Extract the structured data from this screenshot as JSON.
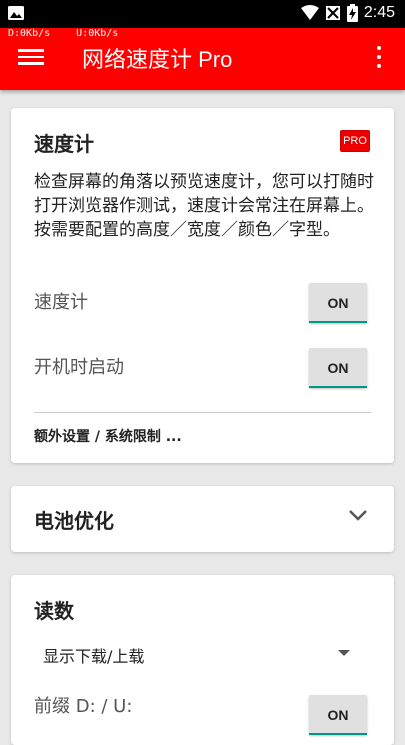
{
  "status_bar": {
    "time": "2:45",
    "icons": [
      "image-icon",
      "wifi-icon",
      "no-sim-icon",
      "battery-charging-icon"
    ]
  },
  "speed_overlay": {
    "download": "D:0Kb/s",
    "upload": "U:0Kb/s"
  },
  "app_bar": {
    "title": "网络速度计 Pro",
    "icons": [
      "menu-icon",
      "more-vert-icon"
    ]
  },
  "card_speedometer": {
    "title": "速度计",
    "badge": "PRO",
    "description": "检查屏幕的角落以预览速度计，您可以打随时打开浏览器作测试，速度计会常注在屏幕上。按需要配置的高度／宽度／颜色／字型。",
    "rows": [
      {
        "label": "速度计",
        "button": "ON"
      },
      {
        "label": "开机时启动",
        "button": "ON"
      }
    ],
    "extra_link": "额外设置 / 系统限制 ..."
  },
  "card_battery": {
    "title": "电池优化",
    "icon": "chevron-down-icon"
  },
  "card_reading": {
    "title": "读数",
    "select_value": "显示下载/上载",
    "prefix_label": "前缀 D: / U:",
    "prefix_button": "ON"
  },
  "colors": {
    "app_bar": "#ff0000",
    "toggle_accent": "#009688",
    "background": "#e8e8e8"
  }
}
